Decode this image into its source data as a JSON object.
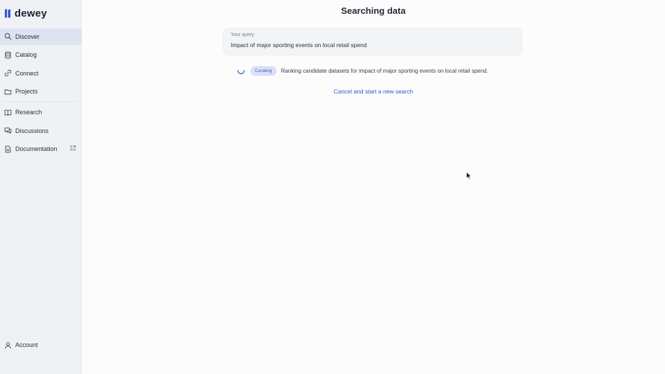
{
  "brand": {
    "name": "dewey",
    "accent": "#2f56c9"
  },
  "sidebar": {
    "items": [
      {
        "label": "Discover",
        "icon": "search-icon",
        "active": true
      },
      {
        "label": "Catalog",
        "icon": "database-icon"
      },
      {
        "label": "Connect",
        "icon": "link-icon"
      },
      {
        "label": "Projects",
        "icon": "folder-icon"
      },
      {
        "label": "Research",
        "icon": "book-icon"
      },
      {
        "label": "Discussions",
        "icon": "chat-icon"
      },
      {
        "label": "Documentation",
        "icon": "document-icon",
        "external": true
      }
    ],
    "account_label": "Account"
  },
  "main": {
    "title": "Searching data",
    "query": {
      "label": "Your query",
      "text": "Impact of major sporting events on local retail spend"
    },
    "status": {
      "badge": "Curating",
      "text": "Ranking candidate datasets for impact of major sporting events on local retail spend."
    },
    "cancel_label": "Cancel and start a new search"
  }
}
